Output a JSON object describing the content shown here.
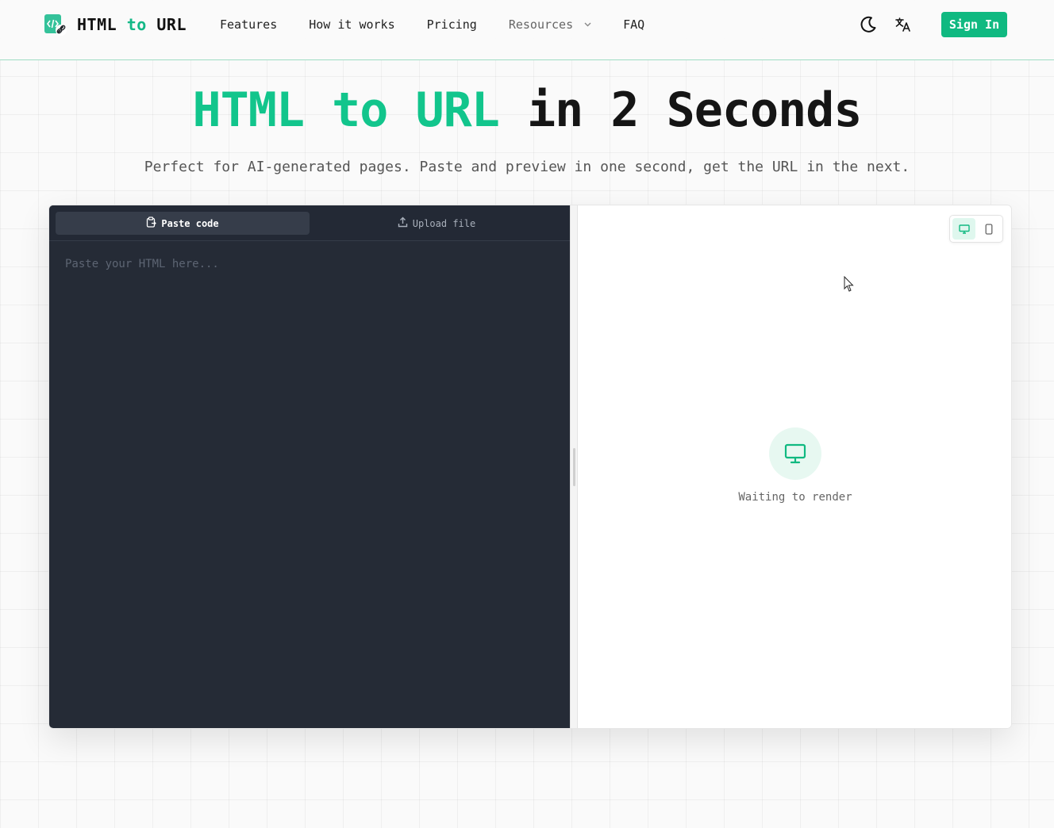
{
  "brand": {
    "name_part1": "HTML",
    "name_part2": "to",
    "name_part3": "URL",
    "accent_color": "#10b981"
  },
  "nav": {
    "items": [
      {
        "label": "Features"
      },
      {
        "label": "How it works"
      },
      {
        "label": "Pricing"
      },
      {
        "label": "Resources"
      },
      {
        "label": "FAQ"
      }
    ],
    "resources_icon": "chevron-down-icon"
  },
  "header_actions": {
    "theme_icon": "moon-icon",
    "language_icon": "translate-icon",
    "signin_label": "Sign In"
  },
  "hero": {
    "title_green": "HTML to URL",
    "title_rest": " in 2 Seconds",
    "subtitle": "Perfect for AI-generated pages. Paste and preview in one second, get the URL in the next."
  },
  "editor": {
    "tabs": [
      {
        "label": "Paste code",
        "icon": "clipboard-icon",
        "active": true
      },
      {
        "label": "Upload file",
        "icon": "upload-icon",
        "active": false
      }
    ],
    "placeholder": "Paste your HTML here...",
    "value": ""
  },
  "preview": {
    "device_modes": [
      {
        "name": "desktop",
        "icon": "desktop-icon",
        "active": true
      },
      {
        "name": "mobile",
        "icon": "mobile-icon",
        "active": false
      }
    ],
    "empty_icon": "monitor-icon",
    "empty_text": "Waiting to render"
  }
}
